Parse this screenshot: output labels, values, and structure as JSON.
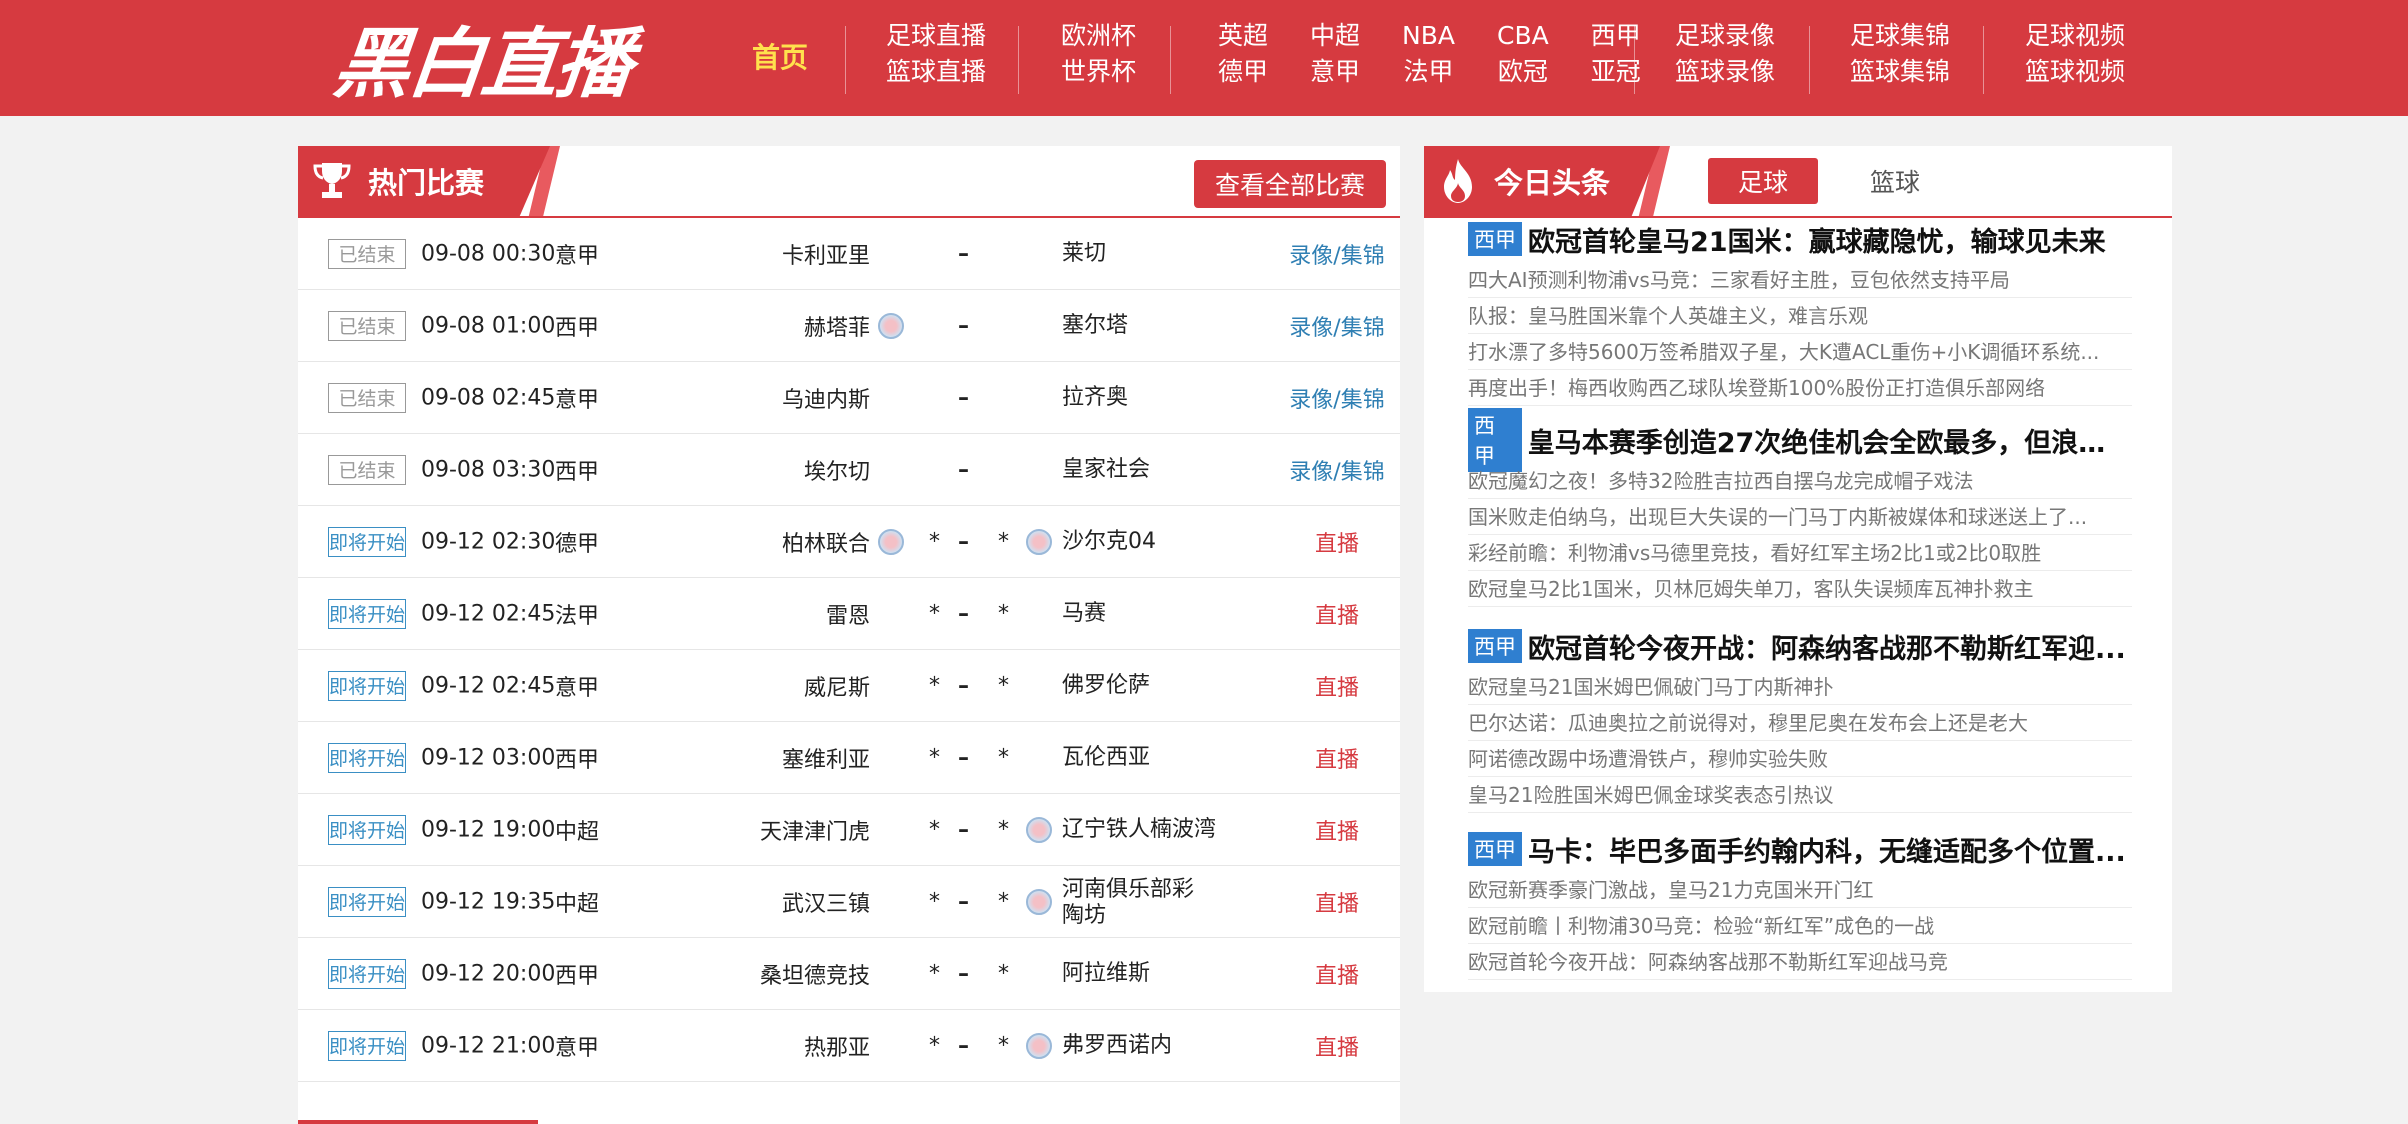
{
  "header": {
    "logo": "黑白直播",
    "home": "首页",
    "nav_groups": [
      [
        [
          "足球直播",
          "篮球直播"
        ]
      ],
      [
        [
          "欧洲杯",
          "世界杯"
        ]
      ],
      [
        [
          "英超",
          "德甲"
        ],
        [
          "中超",
          "意甲"
        ],
        [
          "NBA",
          "法甲"
        ],
        [
          "CBA",
          "欧冠"
        ],
        [
          "西甲",
          "亚冠"
        ]
      ],
      [
        [
          "足球录像",
          "篮球录像"
        ]
      ],
      [
        [
          "足球集锦",
          "篮球集锦"
        ]
      ],
      [
        [
          "足球视频",
          "篮球视频"
        ]
      ]
    ],
    "colors": {
      "primary": "#d63a40",
      "home_highlight": "#ffe14d"
    }
  },
  "hot_matches": {
    "title": "热门比赛",
    "icon": "trophy-icon",
    "view_all": "查看全部比赛",
    "matches": [
      {
        "status": "已结束",
        "state": "ended",
        "time": "09-08 00:30",
        "league": "意甲",
        "home": "卡利亚里",
        "home_icon": false,
        "away": "莱切",
        "away_icon": false,
        "star_home": "",
        "dash": "–",
        "star_away": "",
        "link": "录像/集锦",
        "link_type": "rec"
      },
      {
        "status": "已结束",
        "state": "ended",
        "time": "09-08 01:00",
        "league": "西甲",
        "home": "赫塔菲",
        "home_icon": true,
        "away": "塞尔塔",
        "away_icon": false,
        "star_home": "",
        "dash": "–",
        "star_away": "",
        "link": "录像/集锦",
        "link_type": "rec"
      },
      {
        "status": "已结束",
        "state": "ended",
        "time": "09-08 02:45",
        "league": "意甲",
        "home": "乌迪内斯",
        "home_icon": false,
        "away": "拉齐奥",
        "away_icon": false,
        "star_home": "",
        "dash": "–",
        "star_away": "",
        "link": "录像/集锦",
        "link_type": "rec"
      },
      {
        "status": "已结束",
        "state": "ended",
        "time": "09-08 03:30",
        "league": "西甲",
        "home": "埃尔切",
        "home_icon": false,
        "away": "皇家社会",
        "away_icon": false,
        "star_home": "",
        "dash": "–",
        "star_away": "",
        "link": "录像/集锦",
        "link_type": "rec"
      },
      {
        "status": "即将开始",
        "state": "upcoming",
        "time": "09-12 02:30",
        "league": "德甲",
        "home": "柏林联合",
        "home_icon": true,
        "away": "沙尔克04",
        "away_icon": true,
        "star_home": "*",
        "dash": "–",
        "star_away": "*",
        "link": "直播",
        "link_type": "live"
      },
      {
        "status": "即将开始",
        "state": "upcoming",
        "time": "09-12 02:45",
        "league": "法甲",
        "home": "雷恩",
        "home_icon": false,
        "away": "马赛",
        "away_icon": false,
        "star_home": "*",
        "dash": "–",
        "star_away": "*",
        "link": "直播",
        "link_type": "live"
      },
      {
        "status": "即将开始",
        "state": "upcoming",
        "time": "09-12 02:45",
        "league": "意甲",
        "home": "威尼斯",
        "home_icon": false,
        "away": "佛罗伦萨",
        "away_icon": false,
        "star_home": "*",
        "dash": "–",
        "star_away": "*",
        "link": "直播",
        "link_type": "live"
      },
      {
        "status": "即将开始",
        "state": "upcoming",
        "time": "09-12 03:00",
        "league": "西甲",
        "home": "塞维利亚",
        "home_icon": false,
        "away": "瓦伦西亚",
        "away_icon": false,
        "star_home": "*",
        "dash": "–",
        "star_away": "*",
        "link": "直播",
        "link_type": "live"
      },
      {
        "status": "即将开始",
        "state": "upcoming",
        "time": "09-12 19:00",
        "league": "中超",
        "home": "天津津门虎",
        "home_icon": false,
        "away": "辽宁铁人楠波湾",
        "away_icon": true,
        "star_home": "*",
        "dash": "–",
        "star_away": "*",
        "link": "直播",
        "link_type": "live"
      },
      {
        "status": "即将开始",
        "state": "upcoming",
        "time": "09-12 19:35",
        "league": "中超",
        "home": "武汉三镇",
        "home_icon": false,
        "away": "河南俱乐部彩陶坊",
        "away_icon": true,
        "star_home": "*",
        "dash": "–",
        "star_away": "*",
        "link": "直播",
        "link_type": "live"
      },
      {
        "status": "即将开始",
        "state": "upcoming",
        "time": "09-12 20:00",
        "league": "西甲",
        "home": "桑坦德竞技",
        "home_icon": false,
        "away": "阿拉维斯",
        "away_icon": false,
        "star_home": "*",
        "dash": "–",
        "star_away": "*",
        "link": "直播",
        "link_type": "live"
      },
      {
        "status": "即将开始",
        "state": "upcoming",
        "time": "09-12 21:00",
        "league": "意甲",
        "home": "热那亚",
        "home_icon": false,
        "away": "弗罗西诺内",
        "away_icon": true,
        "star_home": "*",
        "dash": "–",
        "star_away": "*",
        "link": "直播",
        "link_type": "live"
      }
    ]
  },
  "headlines": {
    "title": "今日头条",
    "icon": "flame-icon",
    "tabs": [
      {
        "label": "足球",
        "active": true
      },
      {
        "label": "篮球",
        "active": false
      }
    ],
    "blocks": [
      {
        "tag": "西甲",
        "title": "欧冠首轮皇马21国米：赢球藏隐忧，输球见未来",
        "items": [
          "四大AI预测利物浦vs马竞：三家看好主胜，豆包依然支持平局",
          "队报：皇马胜国米靠个人英雄主义，难言乐观",
          "打水漂了多特5600万签希腊双子星，大K遭ACL重伤+小K调循环系统...",
          "再度出手！梅西收购西乙球队埃登斯100%股份正打造俱乐部网络"
        ]
      },
      {
        "tag": "西甲",
        "title": "皇马本赛季创造27次绝佳机会全欧最多，但浪费...",
        "items": [
          "欧冠魔幻之夜！多特32险胜吉拉西自摆乌龙完成帽子戏法",
          "国米败走伯纳乌，出现巨大失误的一门马丁内斯被媒体和球迷送上了...",
          "彩经前瞻：利物浦vs马德里竞技，看好红军主场2比1或2比0取胜",
          "欧冠皇马2比1国米，贝林厄姆失单刀，客队失误频库瓦神扑救主"
        ]
      },
      {
        "tag": "西甲",
        "title": "欧冠首轮今夜开战：阿森纳客战那不勒斯红军迎...",
        "items": [
          "欧冠皇马21国米姆巴佩破门马丁内斯神扑",
          "巴尔达诺：瓜迪奥拉之前说得对，穆里尼奥在发布会上还是老大",
          "阿诺德改踢中场遭滑铁卢，穆帅实验失败",
          "皇马21险胜国米姆巴佩金球奖表态引热议"
        ]
      },
      {
        "tag": "西甲",
        "title": "马卡：毕巴多面手约翰内科，无缝适配多个位置...",
        "items": [
          "欧冠新赛季豪门激战，皇马21力克国米开门红",
          "欧冠前瞻丨利物浦30马竞：检验“新红军”成色的一战",
          "欧冠首轮今夜开战：阿森纳客战那不勒斯红军迎战马竞"
        ]
      }
    ]
  }
}
